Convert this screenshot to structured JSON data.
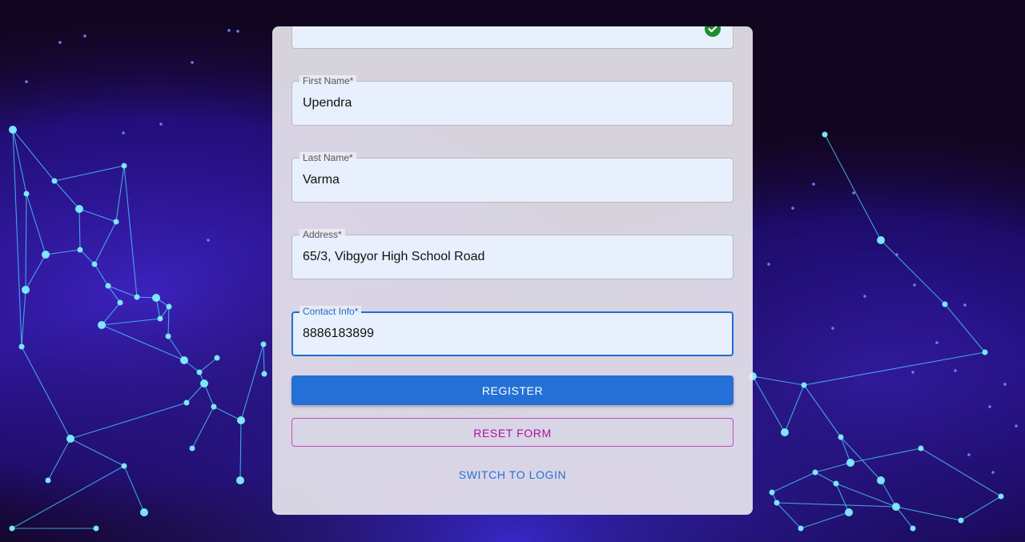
{
  "form": {
    "password": {
      "masked_value": "••••••••"
    },
    "first_name": {
      "label": "First Name*",
      "value": "Upendra"
    },
    "last_name": {
      "label": "Last Name*",
      "value": "Varma"
    },
    "address": {
      "label": "Address*",
      "value": "65/3, Vibgyor High School Road"
    },
    "contact": {
      "label": "Contact Info*",
      "value": "8886183899"
    }
  },
  "buttons": {
    "register": "REGISTER",
    "reset": "RESET FORM",
    "switch": "SWITCH TO LOGIN"
  },
  "colors": {
    "primary": "#2470d6",
    "secondary": "#b10fa8",
    "valid": "#1e8c2e",
    "background": "#12051f"
  },
  "icons": {
    "valid": "check-circle-icon"
  }
}
